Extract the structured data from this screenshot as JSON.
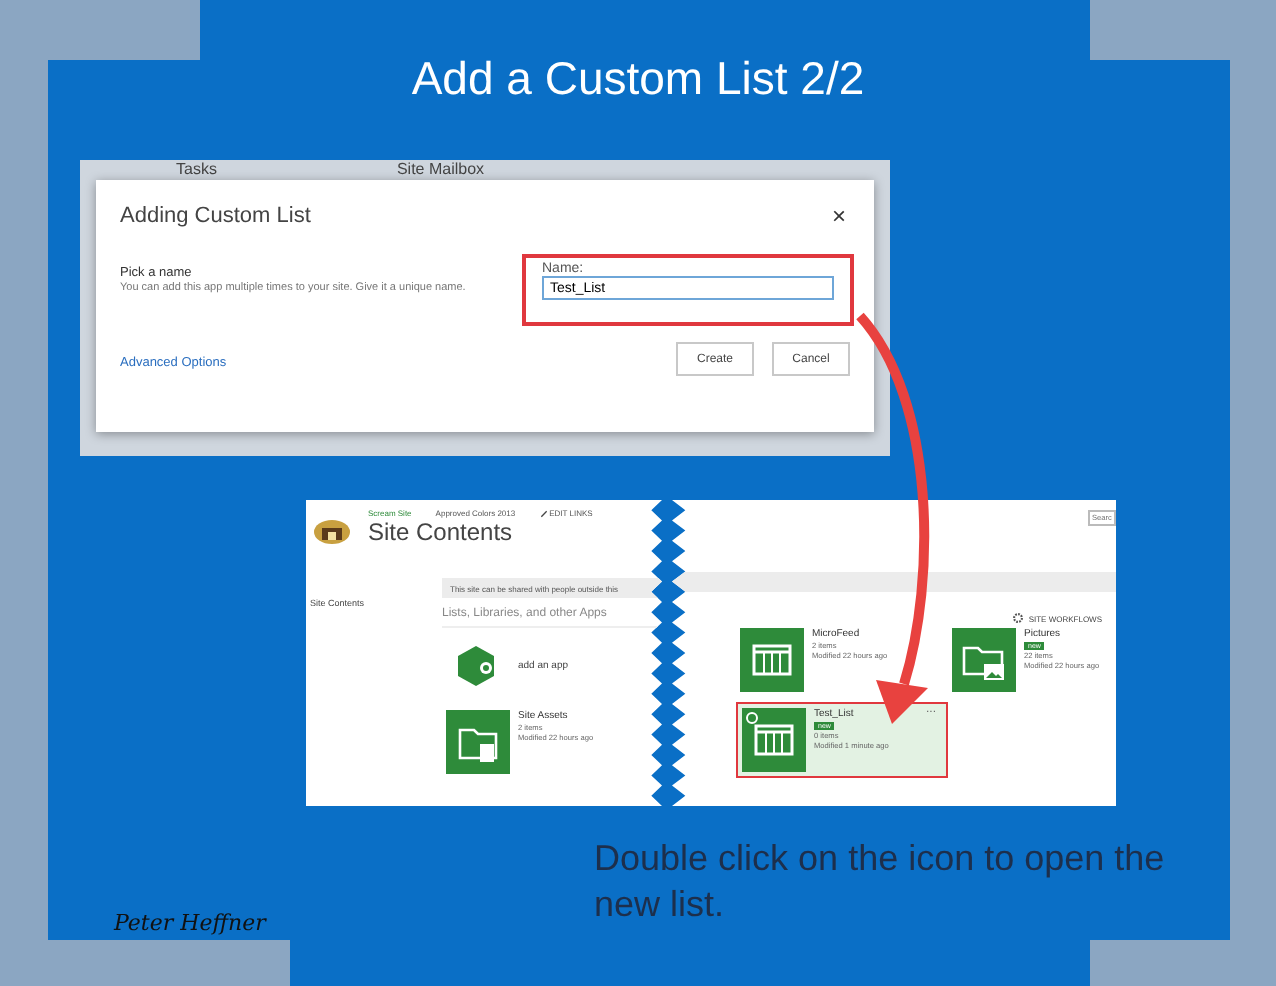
{
  "slide": {
    "title": "Add a Custom List 2/2",
    "caption": "Double click on the icon to open the new list.",
    "author": "Peter Heffner"
  },
  "background_page": {
    "tiles": [
      "Tasks",
      "Site Mailbox"
    ]
  },
  "dialog": {
    "title": "Adding Custom List",
    "close": "×",
    "section_title": "Pick a name",
    "section_text": "You can add this app multiple times to your site. Give it a unique name.",
    "link": "Advanced Options",
    "field_label": "Name:",
    "field_value": "Test_List",
    "field_highlighted": true,
    "buttons": [
      "Create",
      "Cancel"
    ]
  },
  "site": {
    "breadcrumbs": [
      "Scream Site",
      "Approved Colors 2013"
    ],
    "edit_links": "EDIT LINKS",
    "title": "Site Contents",
    "quick_launch": [
      "Site Contents"
    ],
    "search_placeholder": "Searc",
    "share_notice": "This site can be shared with people outside this",
    "section_title": "Lists, Libraries, and other Apps",
    "workflows": "SITE WORKFLOWS",
    "add_app": "add an app",
    "left_apps": [
      {
        "kind": "folder",
        "name": "Site Assets",
        "count": "2 items",
        "modified": "Modified 22 hours ago",
        "selected": false
      }
    ],
    "right_apps": [
      {
        "kind": "list",
        "name": "MicroFeed",
        "count": "2 items",
        "modified": "Modified 22 hours ago",
        "selected": false
      },
      {
        "kind": "picture",
        "name": "Pictures",
        "badge": "new",
        "count": "22 items",
        "modified": "Modified 22 hours ago",
        "selected": false
      },
      {
        "kind": "list",
        "name": "Test_List",
        "badge": "new",
        "count": "0 items",
        "modified": "Modified 1 minute ago",
        "selected": true
      }
    ],
    "more": "..."
  }
}
